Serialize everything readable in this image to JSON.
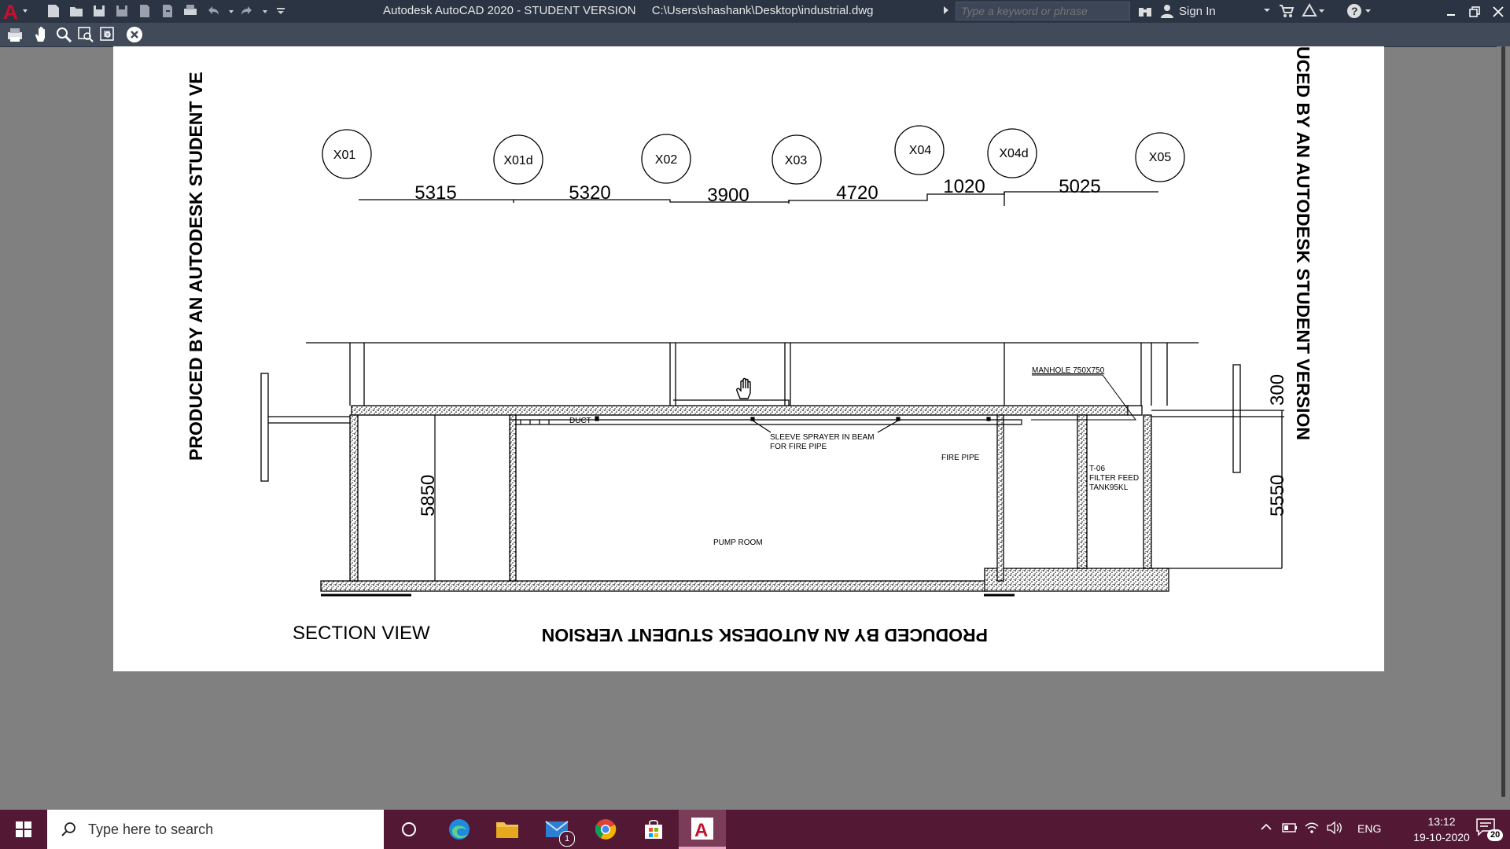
{
  "titlebar": {
    "app_title": "Autodesk AutoCAD 2020 - STUDENT VERSION",
    "file_path": "C:\\Users\\shashank\\Desktop\\industrial.dwg",
    "search_placeholder": "Type a keyword or phrase",
    "sign_in_label": "Sign In"
  },
  "colors": {
    "titlebar_bg": "#2b3443",
    "toolbar_bg": "#414a59",
    "workspace_bg": "#808080",
    "paper_bg": "#ffffff",
    "taskbar_bg": "#531934",
    "autocad_red": "#c8102e"
  },
  "drawing": {
    "grid_bubbles": [
      "X01",
      "X01d",
      "X02",
      "X03",
      "X04",
      "X04d",
      "X05"
    ],
    "grid_dimensions": [
      "5315",
      "5320",
      "3900",
      "4720",
      "1020",
      "5025"
    ],
    "dim_left_height": "5850",
    "dim_right_height": "5550",
    "dim_right_top": "300",
    "labels": {
      "manhole": "MANHOLE 750X750",
      "sleeve_line1": "SLEEVE SPRAYER IN BEAM",
      "sleeve_line2": "FOR FIRE PIPE",
      "fire_pipe": "FIRE PIPE",
      "tank_line1": "T-06",
      "tank_line2": "FILTER FEED",
      "tank_line3": "TANK95KL",
      "pump_room": "PUMP ROOM",
      "duct": "DUCT",
      "section_view": "SECTION VIEW"
    },
    "watermark_left": "PRODUCED BY AN AUTODESK STUDENT VE",
    "watermark_right": "UCED BY AN AUTODESK STUDENT VERSION",
    "watermark_bottom": "PRODUCED BY AN AUTODESK STUDENT VERSION"
  },
  "taskbar": {
    "search_placeholder": "Type here to search",
    "mail_badge": "1",
    "language": "ENG",
    "time": "13:12",
    "date": "19-10-2020",
    "notifications_count": "20"
  }
}
